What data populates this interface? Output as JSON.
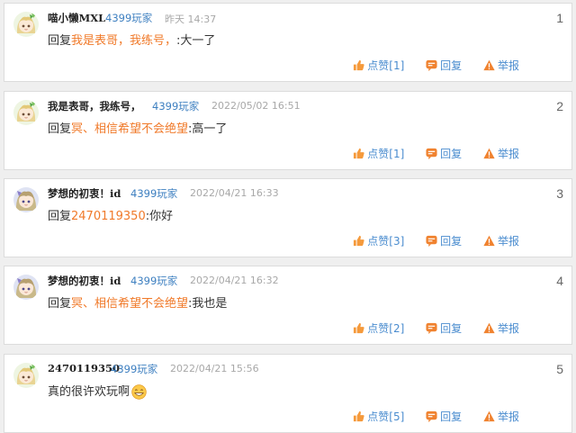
{
  "labels": {
    "reply_prefix": "回复",
    "like": "点赞",
    "reply": "回复",
    "report": "举报"
  },
  "colors": {
    "accent_orange": "#f07a2a",
    "link_blue": "#3d7fc0",
    "like_icon": "#f59a3c",
    "reply_icon": "#f0822f",
    "report_icon": "#f0822f"
  },
  "comments": [
    {
      "index": "1",
      "avatar": "anime-girl-green-hair",
      "name": "喵小懒MXL",
      "role": "4399玩家",
      "time": "昨天 14:37",
      "reply_target": "我是表哥，我练号，",
      "separator": ":",
      "content": "大一了",
      "likes": "1",
      "emoji": ""
    },
    {
      "index": "2",
      "avatar": "anime-girl-green-hair",
      "name": "我是表哥，我练号，",
      "role": "4399玩家",
      "time": "2022/05/02 16:51",
      "reply_target": "冥、相信希望不会绝望",
      "separator": ":",
      "content": "高一了",
      "likes": "1",
      "emoji": ""
    },
    {
      "index": "3",
      "avatar": "anime-girl-purple",
      "name": "梦想的初衷！id",
      "role": "4399玩家",
      "time": "2022/04/21 16:33",
      "reply_target": "2470119350",
      "separator": ":",
      "content": "你好",
      "likes": "3",
      "emoji": ""
    },
    {
      "index": "4",
      "avatar": "anime-girl-purple",
      "name": "梦想的初衷！id",
      "role": "4399玩家",
      "time": "2022/04/21 16:32",
      "reply_target": "冥、相信希望不会绝望",
      "separator": ":",
      "content": "我也是",
      "likes": "2",
      "emoji": ""
    },
    {
      "index": "5",
      "avatar": "anime-girl-green-hair",
      "name": "2470119350",
      "role": "4399玩家",
      "time": "2022/04/21 15:56",
      "reply_target": "",
      "separator": "",
      "content": "真的很许欢玩啊",
      "likes": "5",
      "emoji": "grinning-face-emoji"
    }
  ]
}
